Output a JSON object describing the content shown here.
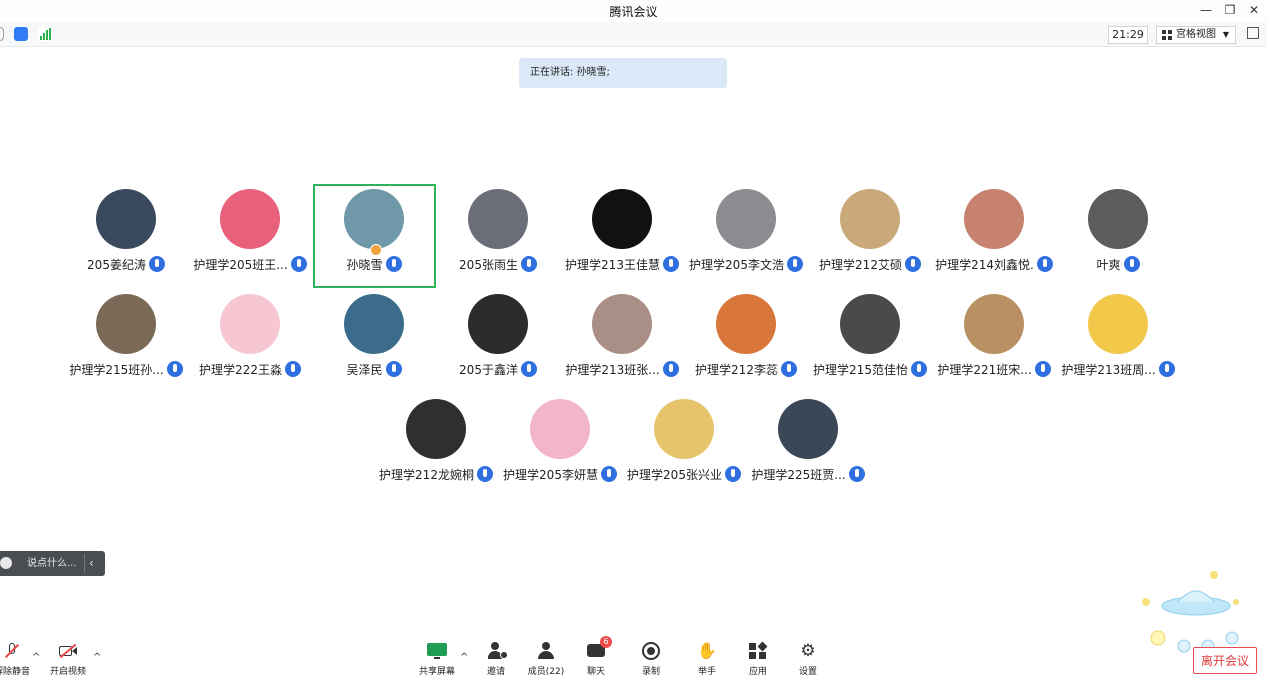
{
  "window": {
    "title": "腾讯会议"
  },
  "toolbar": {
    "time": "21:29",
    "view_label": "宫格视图"
  },
  "speaking": {
    "text": "正在讲话: 孙晓雪;"
  },
  "colors": {
    "accent": "#2f6fe0",
    "active_speaker_border": "#2fb25b",
    "leave": "#e84b4b"
  },
  "participants": [
    {
      "name": "205姜纪涛",
      "avatar_color": "#3a4a5e",
      "highlighted": false
    },
    {
      "name": "护理学205班王...",
      "avatar_color": "#e8607a",
      "highlighted": false
    },
    {
      "name": "孙晓雪",
      "avatar_color": "#6f98a8",
      "highlighted": true,
      "host": true
    },
    {
      "name": "205张雨生",
      "avatar_color": "#6b6d78",
      "highlighted": false
    },
    {
      "name": "护理学213王佳慧",
      "avatar_color": "#111111",
      "highlighted": false
    },
    {
      "name": "护理学205李文浩",
      "avatar_color": "#8a8c90",
      "highlighted": false
    },
    {
      "name": "护理学212艾硕",
      "avatar_color": "#c9a97a",
      "highlighted": false
    },
    {
      "name": "护理学214刘鑫悦.",
      "avatar_color": "#c7826f",
      "highlighted": false
    },
    {
      "name": "叶爽",
      "avatar_color": "#5c5c5c",
      "highlighted": false
    },
    {
      "name": "护理学215班孙...",
      "avatar_color": "#7b6a58",
      "highlighted": false
    },
    {
      "name": "护理学222王淼",
      "avatar_color": "#f6c6d3",
      "highlighted": false
    },
    {
      "name": "吴泽民",
      "avatar_color": "#3c6c8c",
      "highlighted": false
    },
    {
      "name": "205于鑫洋",
      "avatar_color": "#2c2c2c",
      "highlighted": false
    },
    {
      "name": "护理学213班张...",
      "avatar_color": "#a98f86",
      "highlighted": false
    },
    {
      "name": "护理学212李蕊",
      "avatar_color": "#d9763a",
      "highlighted": false
    },
    {
      "name": "护理学215范佳怡",
      "avatar_color": "#4a4a4a",
      "highlighted": false
    },
    {
      "name": "护理学221班宋...",
      "avatar_color": "#b99063",
      "highlighted": false
    },
    {
      "name": "护理学213班周...",
      "avatar_color": "#f1c84a",
      "highlighted": false
    },
    {
      "name": "护理学212龙婉桐",
      "avatar_color": "#2f2f2f",
      "highlighted": false
    },
    {
      "name": "护理学205李妍慧",
      "avatar_color": "#f3b6c8",
      "highlighted": false
    },
    {
      "name": "护理学205张兴业",
      "avatar_color": "#e6c46b",
      "highlighted": false
    },
    {
      "name": "护理学225班贾...",
      "avatar_color": "#3b4656",
      "highlighted": false
    }
  ],
  "chat": {
    "placeholder": "说点什么..."
  },
  "bottom": {
    "mute": "解除静音",
    "video": "开启视频",
    "share": "共享屏幕",
    "invite": "邀请",
    "members": "成员(22)",
    "chat": "聊天",
    "chat_badge": "6",
    "record": "录制",
    "raise_hand": "举手",
    "apps": "应用",
    "settings": "设置",
    "leave": "离开会议"
  }
}
